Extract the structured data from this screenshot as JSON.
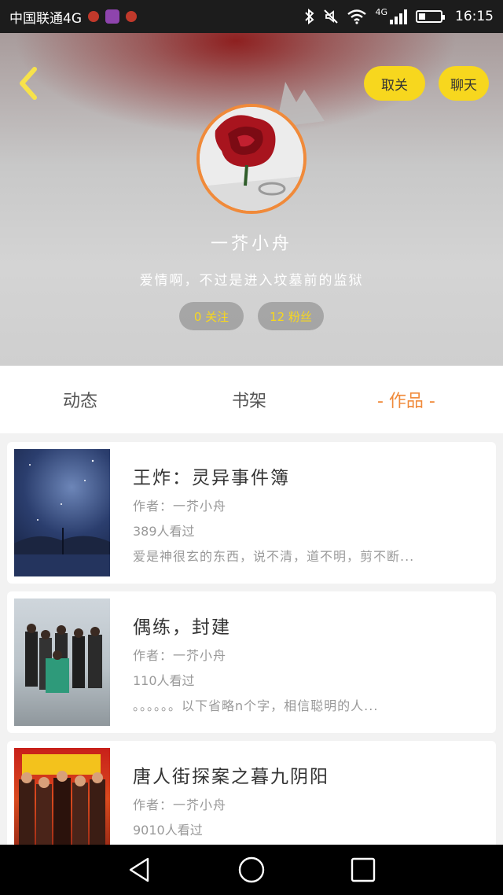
{
  "status_bar": {
    "carrier": "中国联通4G",
    "network": "4G",
    "time": "16:15"
  },
  "header": {
    "unfollow_label": "取关",
    "chat_label": "聊天",
    "username": "一芥小舟",
    "bio": "爱情啊，不过是进入坟墓前的监狱",
    "follow_stat": "0 关注",
    "fans_stat": "12 粉丝"
  },
  "tabs": [
    {
      "label": "动态"
    },
    {
      "label": "书架"
    },
    {
      "label": "- 作品 -"
    }
  ],
  "works": [
    {
      "title": "王炸：灵异事件簿",
      "author": "作者：一芥小舟",
      "views": "389人看过",
      "desc": "爱是神很玄的东西，说不清，道不明，剪不断..."
    },
    {
      "title": "偶练，封建",
      "author": "作者：一芥小舟",
      "views": "110人看过",
      "desc": "。。。。。。以下省略n个字，相信聪明的人..."
    },
    {
      "title": "唐人街探案之暮九阴阳",
      "author": "作者：一芥小舟",
      "views": "9010人看过",
      "desc": ""
    }
  ],
  "colors": {
    "accent_orange": "#f08a3a",
    "button_yellow": "#f7d71e"
  }
}
